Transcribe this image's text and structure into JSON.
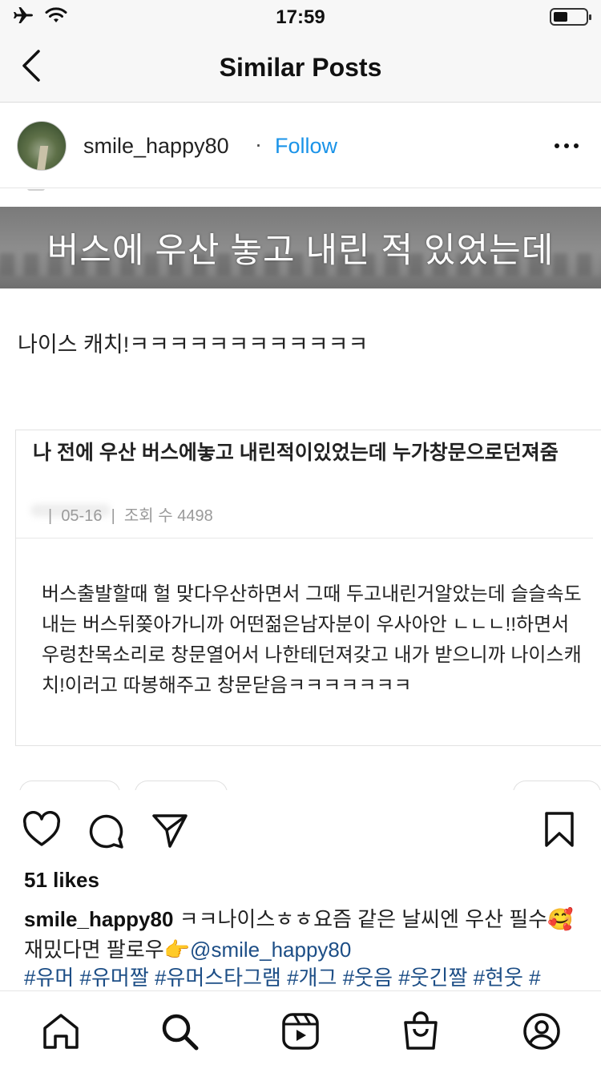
{
  "status_bar": {
    "time": "17:59",
    "battery_level": 0.45,
    "icons": [
      "airplane-icon",
      "wifi-icon",
      "battery-icon"
    ]
  },
  "nav": {
    "title": "Similar Posts",
    "back_icon": "chevron-left-icon"
  },
  "post": {
    "username": "smile_happy80",
    "separator": "·",
    "follow_label": "Follow",
    "more_icon": "more-horizontal-icon"
  },
  "image": {
    "banner_text": "버스에 우산 놓고 내린 적 있었는데",
    "caption_line": "나이스 캐치!ㅋㅋㅋㅋㅋㅋㅋㅋㅋㅋㅋㅋ",
    "card": {
      "title": "나 전에 우산 버스에놓고 내린적이있었는데 누가창문으로던져줌",
      "date": "05-16",
      "views": "조회 수 4498",
      "body": "버스출발할때 헐 맞다우산하면서 그때 두고내린거알았는데 슬슬속도내는 버스뒤쫒아가니까 어떤젊은남자분이 우사아안 ㄴㄴㄴ!!하면서 우렁찬목소리로 창문열어서 나한테던져갖고 내가 받으니까 나이스캐치!이러고 따봉해주고 창문닫음ㅋㅋㅋㅋㅋㅋㅋ"
    }
  },
  "actions": {
    "like_icon": "heart-icon",
    "comment_icon": "comment-icon",
    "share_icon": "send-icon",
    "save_icon": "bookmark-icon"
  },
  "likes": "51 likes",
  "caption": {
    "username": "smile_happy80",
    "text": " ㅋㅋ나이스ㅎㅎ요즘 같은 날씨엔 우산 필수🥰재밌다면 팔로우👉",
    "mention": "@smile_happy80"
  },
  "hashtags": "#유머 #유머짤 #유머스타그램 #개그 #웃음 #웃긴짤 #현웃 #",
  "tab_bar": {
    "items": [
      "home-icon",
      "search-icon",
      "reels-icon",
      "shop-icon",
      "profile-icon"
    ]
  },
  "colors": {
    "accent": "#1a93e8",
    "link": "#1d4e86",
    "nav_bg": "#f7f7f7"
  }
}
